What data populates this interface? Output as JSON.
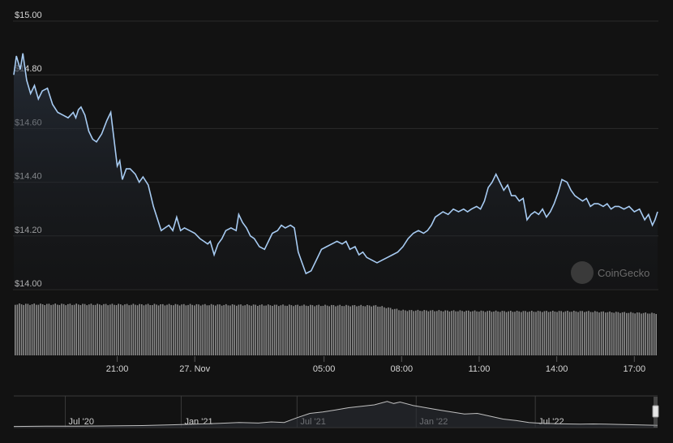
{
  "colors": {
    "background": "#121212",
    "price_line": "#a7cbf2",
    "area_fill_top": "#2a3340",
    "grid": "#2b2b2b",
    "volume_bar": "#8a8a8a",
    "navigator_line": "#bfbfbf"
  },
  "watermark": {
    "text": "CoinGecko",
    "icon": "coingecko-logo-icon"
  },
  "chart_data": {
    "type": "line",
    "y_ticks": [
      "$15.00",
      "$14.80",
      "$14.60",
      "$14.40",
      "$14.20",
      "$14.00"
    ],
    "ylim": [
      14.0,
      15.0
    ],
    "x_ticks": [
      "21:00",
      "27. Nov",
      "05:00",
      "08:00",
      "11:00",
      "14:00",
      "17:00"
    ],
    "x_tick_hours": [
      21,
      24,
      29,
      32,
      35,
      38,
      41
    ],
    "xlim_hours": [
      17.0,
      41.9
    ],
    "series": [
      {
        "price": [
          [
            17.0,
            14.8
          ],
          [
            17.1,
            14.87
          ],
          [
            17.25,
            14.82
          ],
          [
            17.35,
            14.88
          ],
          [
            17.5,
            14.78
          ],
          [
            17.65,
            14.73
          ],
          [
            17.8,
            14.76
          ],
          [
            17.95,
            14.71
          ],
          [
            18.1,
            14.74
          ],
          [
            18.3,
            14.75
          ],
          [
            18.5,
            14.69
          ],
          [
            18.7,
            14.66
          ],
          [
            18.9,
            14.65
          ],
          [
            19.1,
            14.64
          ],
          [
            19.3,
            14.66
          ],
          [
            19.4,
            14.64
          ],
          [
            19.5,
            14.67
          ],
          [
            19.6,
            14.68
          ],
          [
            19.75,
            14.65
          ],
          [
            19.9,
            14.59
          ],
          [
            20.05,
            14.56
          ],
          [
            20.2,
            14.55
          ],
          [
            20.4,
            14.58
          ],
          [
            20.6,
            14.63
          ],
          [
            20.75,
            14.66
          ],
          [
            20.85,
            14.58
          ],
          [
            21.0,
            14.46
          ],
          [
            21.1,
            14.48
          ],
          [
            21.2,
            14.41
          ],
          [
            21.35,
            14.45
          ],
          [
            21.5,
            14.45
          ],
          [
            21.7,
            14.43
          ],
          [
            21.85,
            14.4
          ],
          [
            22.0,
            14.42
          ],
          [
            22.2,
            14.39
          ],
          [
            22.4,
            14.31
          ],
          [
            22.6,
            14.25
          ],
          [
            22.7,
            14.22
          ],
          [
            22.85,
            14.23
          ],
          [
            23.0,
            14.24
          ],
          [
            23.15,
            14.22
          ],
          [
            23.3,
            14.27
          ],
          [
            23.45,
            14.22
          ],
          [
            23.6,
            14.23
          ],
          [
            23.8,
            14.22
          ],
          [
            24.0,
            14.21
          ],
          [
            24.2,
            14.19
          ],
          [
            24.35,
            14.18
          ],
          [
            24.5,
            14.17
          ],
          [
            24.6,
            14.18
          ],
          [
            24.75,
            14.13
          ],
          [
            24.9,
            14.17
          ],
          [
            25.05,
            14.19
          ],
          [
            25.2,
            14.22
          ],
          [
            25.4,
            14.23
          ],
          [
            25.6,
            14.22
          ],
          [
            25.7,
            14.28
          ],
          [
            25.85,
            14.25
          ],
          [
            26.0,
            14.23
          ],
          [
            26.15,
            14.2
          ],
          [
            26.3,
            14.19
          ],
          [
            26.5,
            14.16
          ],
          [
            26.7,
            14.15
          ],
          [
            26.85,
            14.18
          ],
          [
            27.0,
            14.21
          ],
          [
            27.2,
            14.22
          ],
          [
            27.35,
            14.24
          ],
          [
            27.5,
            14.23
          ],
          [
            27.7,
            14.24
          ],
          [
            27.85,
            14.23
          ],
          [
            28.0,
            14.14
          ],
          [
            28.15,
            14.1
          ],
          [
            28.3,
            14.06
          ],
          [
            28.5,
            14.07
          ],
          [
            28.7,
            14.11
          ],
          [
            28.9,
            14.15
          ],
          [
            29.1,
            14.16
          ],
          [
            29.3,
            14.17
          ],
          [
            29.5,
            14.18
          ],
          [
            29.7,
            14.17
          ],
          [
            29.85,
            14.18
          ],
          [
            30.0,
            14.15
          ],
          [
            30.2,
            14.16
          ],
          [
            30.35,
            14.13
          ],
          [
            30.5,
            14.14
          ],
          [
            30.65,
            14.12
          ],
          [
            30.85,
            14.11
          ],
          [
            31.05,
            14.1
          ],
          [
            31.25,
            14.11
          ],
          [
            31.45,
            14.12
          ],
          [
            31.65,
            14.13
          ],
          [
            31.85,
            14.14
          ],
          [
            32.05,
            14.16
          ],
          [
            32.25,
            14.19
          ],
          [
            32.45,
            14.21
          ],
          [
            32.65,
            14.22
          ],
          [
            32.85,
            14.21
          ],
          [
            33.0,
            14.22
          ],
          [
            33.15,
            14.24
          ],
          [
            33.3,
            14.27
          ],
          [
            33.45,
            14.28
          ],
          [
            33.6,
            14.29
          ],
          [
            33.8,
            14.28
          ],
          [
            34.0,
            14.3
          ],
          [
            34.2,
            14.29
          ],
          [
            34.4,
            14.3
          ],
          [
            34.55,
            14.29
          ],
          [
            34.7,
            14.3
          ],
          [
            34.9,
            14.31
          ],
          [
            35.05,
            14.3
          ],
          [
            35.2,
            14.33
          ],
          [
            35.35,
            14.38
          ],
          [
            35.5,
            14.4
          ],
          [
            35.65,
            14.43
          ],
          [
            35.8,
            14.4
          ],
          [
            35.95,
            14.37
          ],
          [
            36.1,
            14.39
          ],
          [
            36.25,
            14.35
          ],
          [
            36.4,
            14.35
          ],
          [
            36.55,
            14.33
          ],
          [
            36.7,
            14.34
          ],
          [
            36.85,
            14.26
          ],
          [
            37.0,
            14.28
          ],
          [
            37.15,
            14.29
          ],
          [
            37.3,
            14.28
          ],
          [
            37.45,
            14.3
          ],
          [
            37.6,
            14.27
          ],
          [
            37.75,
            14.29
          ],
          [
            37.9,
            14.32
          ],
          [
            38.05,
            14.36
          ],
          [
            38.2,
            14.41
          ],
          [
            38.4,
            14.4
          ],
          [
            38.55,
            14.37
          ],
          [
            38.7,
            14.35
          ],
          [
            38.85,
            14.34
          ],
          [
            39.0,
            14.33
          ],
          [
            39.15,
            14.34
          ],
          [
            39.3,
            14.31
          ],
          [
            39.45,
            14.32
          ],
          [
            39.6,
            14.32
          ],
          [
            39.8,
            14.31
          ],
          [
            39.95,
            14.32
          ],
          [
            40.1,
            14.3
          ],
          [
            40.25,
            14.31
          ],
          [
            40.4,
            14.31
          ],
          [
            40.6,
            14.3
          ],
          [
            40.8,
            14.31
          ],
          [
            41.0,
            14.29
          ],
          [
            41.2,
            14.3
          ],
          [
            41.4,
            14.26
          ],
          [
            41.55,
            14.28
          ],
          [
            41.7,
            14.24
          ],
          [
            41.8,
            14.26
          ],
          [
            41.9,
            14.29
          ]
        ]
      }
    ],
    "volume": {
      "note_relative_levels": "relative volume (1.0 = highest visible bar)",
      "profile": [
        [
          17.0,
          1.0
        ],
        [
          24.0,
          0.99
        ],
        [
          31.0,
          0.97
        ],
        [
          32.0,
          0.88
        ],
        [
          36.0,
          0.86
        ],
        [
          39.0,
          0.86
        ],
        [
          41.9,
          0.82
        ]
      ]
    },
    "navigator": {
      "x_ticks": [
        "Jul '20",
        "Jan '21",
        "Jul '21",
        "Jan '22",
        "Jul '22"
      ],
      "x_tick_frac": [
        0.08,
        0.26,
        0.44,
        0.625,
        0.81
      ],
      "series": [
        [
          0.0,
          0.04
        ],
        [
          0.05,
          0.05
        ],
        [
          0.1,
          0.05
        ],
        [
          0.15,
          0.06
        ],
        [
          0.2,
          0.07
        ],
        [
          0.25,
          0.1
        ],
        [
          0.28,
          0.12
        ],
        [
          0.32,
          0.15
        ],
        [
          0.35,
          0.18
        ],
        [
          0.38,
          0.16
        ],
        [
          0.4,
          0.2
        ],
        [
          0.42,
          0.18
        ],
        [
          0.44,
          0.35
        ],
        [
          0.46,
          0.5
        ],
        [
          0.48,
          0.55
        ],
        [
          0.5,
          0.62
        ],
        [
          0.52,
          0.7
        ],
        [
          0.54,
          0.75
        ],
        [
          0.56,
          0.8
        ],
        [
          0.58,
          0.92
        ],
        [
          0.59,
          0.85
        ],
        [
          0.6,
          0.9
        ],
        [
          0.62,
          0.78
        ],
        [
          0.64,
          0.7
        ],
        [
          0.66,
          0.62
        ],
        [
          0.68,
          0.55
        ],
        [
          0.7,
          0.48
        ],
        [
          0.72,
          0.5
        ],
        [
          0.74,
          0.4
        ],
        [
          0.76,
          0.3
        ],
        [
          0.78,
          0.25
        ],
        [
          0.8,
          0.18
        ],
        [
          0.82,
          0.15
        ],
        [
          0.84,
          0.14
        ],
        [
          0.86,
          0.13
        ],
        [
          0.88,
          0.12
        ],
        [
          0.9,
          0.13
        ],
        [
          0.92,
          0.12
        ],
        [
          0.94,
          0.11
        ],
        [
          0.96,
          0.1
        ],
        [
          0.98,
          0.09
        ],
        [
          1.0,
          0.08
        ]
      ]
    }
  }
}
